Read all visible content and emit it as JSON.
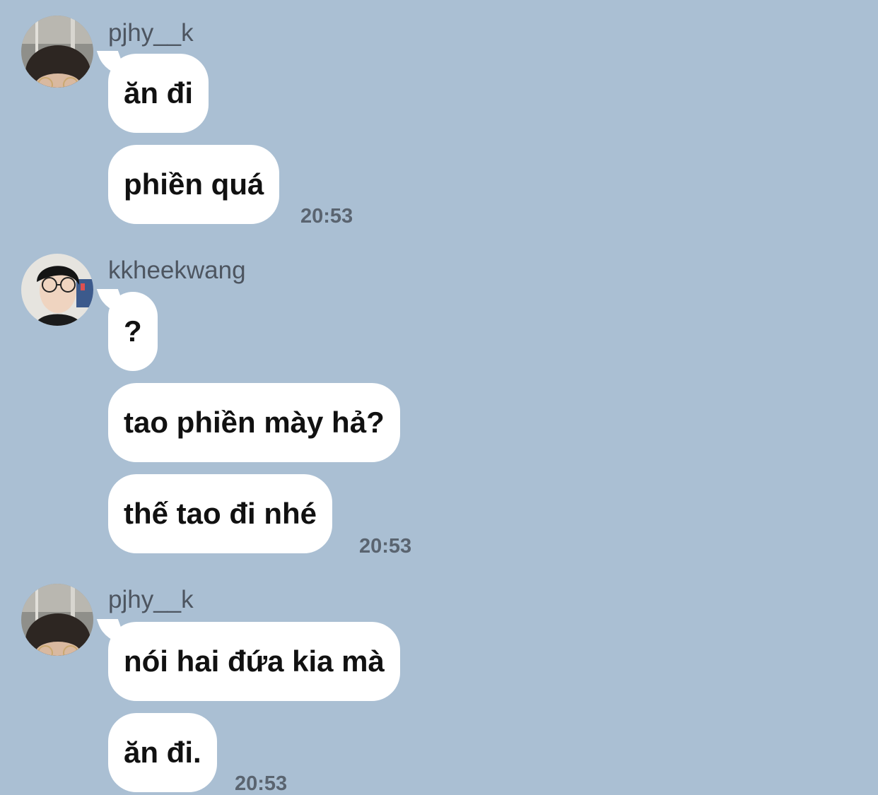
{
  "messages": [
    {
      "sender": "pjhy__k",
      "avatar_icon": "user-avatar-icon",
      "bubbles": [
        "ăn đi",
        "phiền quá"
      ],
      "time": "20:53"
    },
    {
      "sender": "kkheekwang",
      "avatar_icon": "user-avatar-icon",
      "bubbles": [
        "?",
        "tao phiền mày hả?",
        "thế tao đi nhé"
      ],
      "time": "20:53"
    },
    {
      "sender": "pjhy__k",
      "avatar_icon": "user-avatar-icon",
      "bubbles": [
        "nói hai đứa kia mà",
        "ăn đi."
      ],
      "time": "20:53"
    }
  ],
  "colors": {
    "background": "#aabfd3",
    "bubble": "#ffffff",
    "sender_name": "#4d5560",
    "timestamp": "#5a6470"
  }
}
